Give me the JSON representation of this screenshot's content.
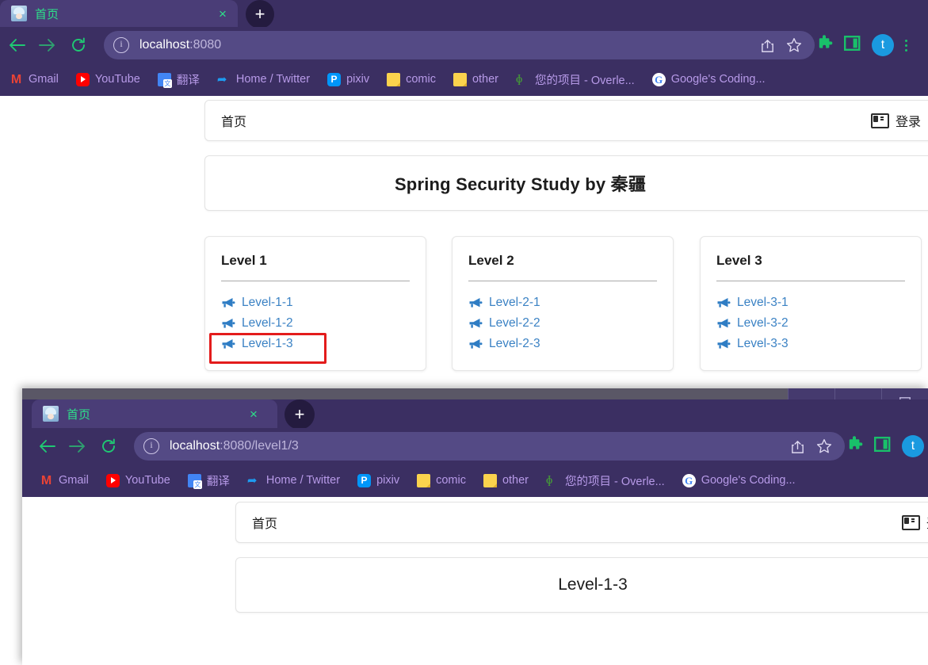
{
  "windows": {
    "back": {
      "tab": {
        "title": "首页",
        "close_label": "×",
        "newtab_label": "+"
      },
      "omnibox": {
        "url_main": "localhost",
        "url_rest": ":8080",
        "info_icon": "i"
      },
      "bookmarks": [
        {
          "label": "Gmail",
          "icon": "gmail-icon"
        },
        {
          "label": "YouTube",
          "icon": "youtube-icon"
        },
        {
          "label": "翻译",
          "icon": "google-translate-icon"
        },
        {
          "label": "Home / Twitter",
          "icon": "twitter-icon"
        },
        {
          "label": "pixiv",
          "icon": "pixiv-icon"
        },
        {
          "label": "comic",
          "icon": "folder-icon"
        },
        {
          "label": "other",
          "icon": "folder-icon"
        },
        {
          "label": "您的项目 - Overle...",
          "icon": "overleaf-icon"
        },
        {
          "label": "Google's Coding...",
          "icon": "google-icon"
        }
      ],
      "avatar_letter": "t",
      "page": {
        "nav": {
          "home": "首页",
          "login": "登录"
        },
        "hero_title": "Spring Security Study by 秦疆",
        "cards": [
          {
            "title": "Level 1",
            "links": [
              "Level-1-1",
              "Level-1-2",
              "Level-1-3"
            ]
          },
          {
            "title": "Level 2",
            "links": [
              "Level-2-1",
              "Level-2-2",
              "Level-2-3"
            ]
          },
          {
            "title": "Level 3",
            "links": [
              "Level-3-1",
              "Level-3-2",
              "Level-3-3"
            ]
          }
        ]
      }
    },
    "front": {
      "tab": {
        "title": "首页",
        "close_label": "×",
        "newtab_label": "+"
      },
      "omnibox": {
        "url_main": "localhost",
        "url_rest": ":8080/level1/3",
        "info_icon": "i"
      },
      "bookmarks": [
        {
          "label": "Gmail",
          "icon": "gmail-icon"
        },
        {
          "label": "YouTube",
          "icon": "youtube-icon"
        },
        {
          "label": "翻译",
          "icon": "google-translate-icon"
        },
        {
          "label": "Home / Twitter",
          "icon": "twitter-icon"
        },
        {
          "label": "pixiv",
          "icon": "pixiv-icon"
        },
        {
          "label": "comic",
          "icon": "folder-icon"
        },
        {
          "label": "other",
          "icon": "folder-icon"
        },
        {
          "label": "您的项目 - Overle...",
          "icon": "overleaf-icon"
        },
        {
          "label": "Google's Coding...",
          "icon": "google-icon"
        }
      ],
      "avatar_letter": "t",
      "page": {
        "nav": {
          "home": "首页",
          "login": "登录"
        },
        "heading": "Level-1-3"
      }
    }
  },
  "colors": {
    "chrome_toolbar": "#3b2f62",
    "chrome_tab_active": "#4a3d77",
    "omnibox": "#544a85",
    "tab_title_green": "#2ee08a",
    "bookmark_label": "#b79ae8",
    "link_blue": "#3b82c4",
    "annotation_red": "#e31c1c",
    "avatar_blue": "#1a9ae0",
    "window_frame_gray": "#5a5766"
  },
  "annotation": {
    "target": "Level-1-3",
    "shape": "rectangle"
  }
}
